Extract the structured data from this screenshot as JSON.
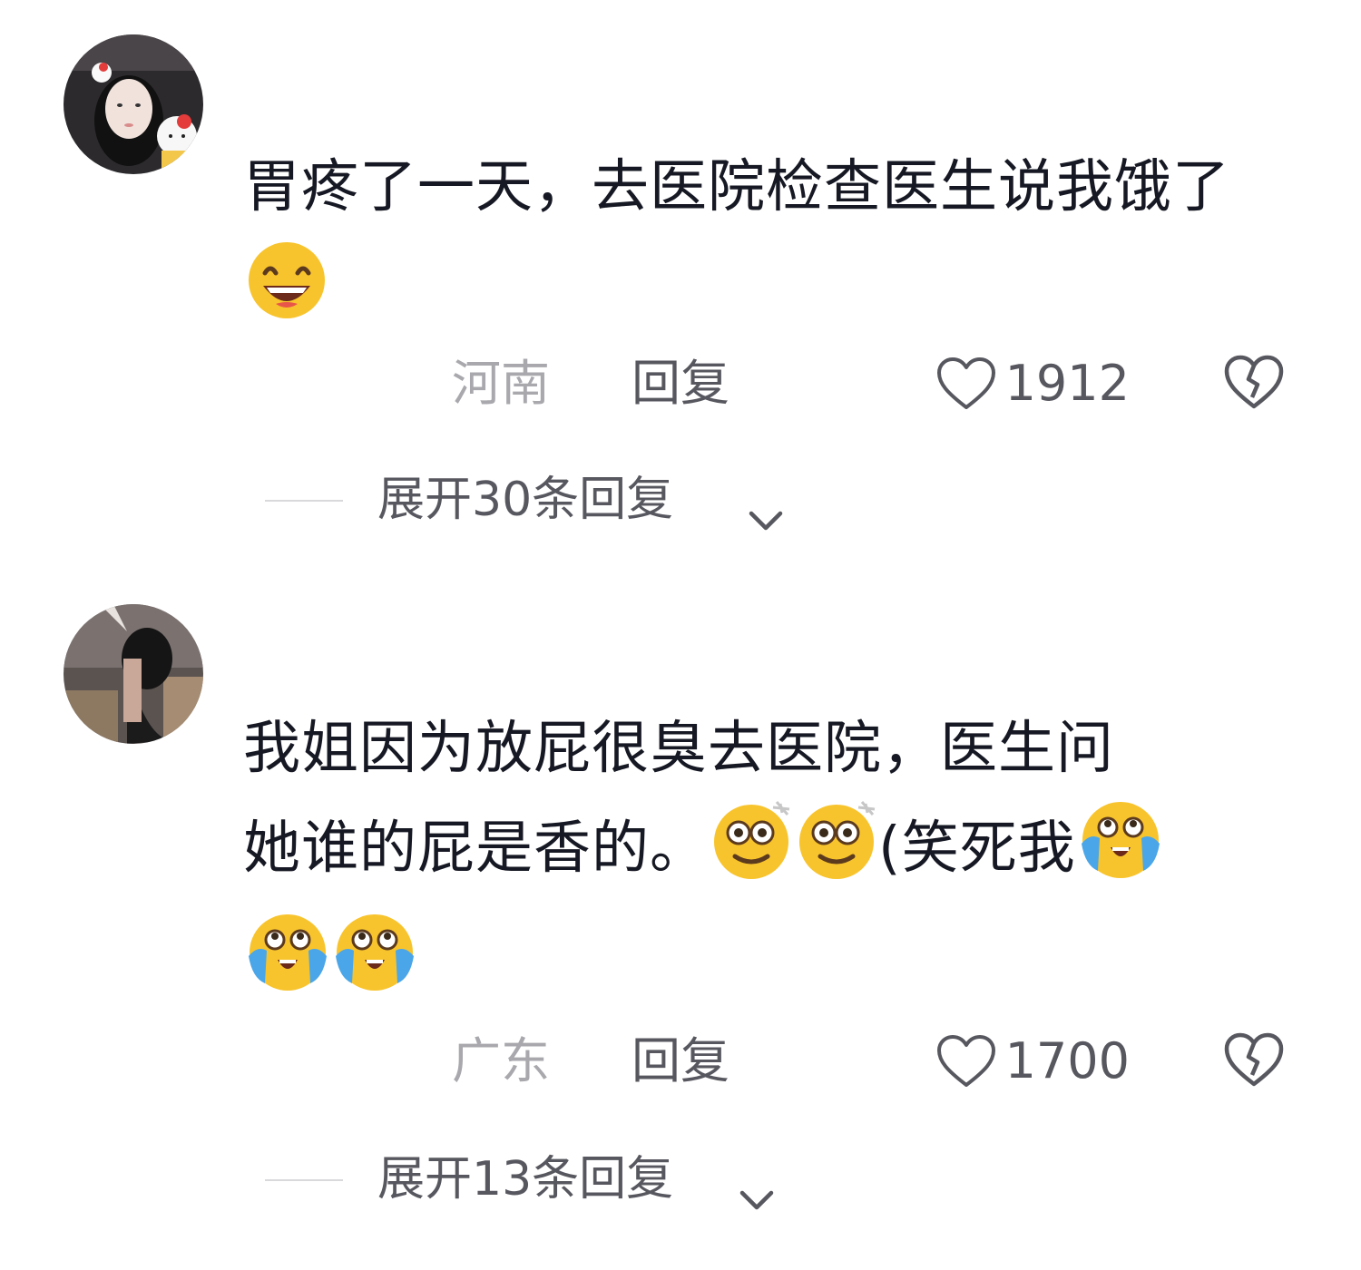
{
  "comments": [
    {
      "text": "胃疼了一天，去医院检查医生说我饿了",
      "emojis": [
        "grinning-face-emoji"
      ],
      "location": "河南",
      "reply_label": "回复",
      "likes": "1912",
      "expand_label": "展开30条回复",
      "icons": {
        "like": "heart-outline-icon",
        "dislike": "broken-heart-icon",
        "expand": "chevron-down-icon"
      }
    },
    {
      "text_line1": "我姐因为放屁很臭去医院，医生问",
      "text_line2": "她谁的屁是香的。",
      "text_line3": "(笑死我",
      "emojis": [
        "dizzy-smile-emoji",
        "dizzy-smile-emoji",
        "loudly-crying-laughing-emoji",
        "loudly-crying-laughing-emoji",
        "loudly-crying-laughing-emoji"
      ],
      "location": "广东",
      "reply_label": "回复",
      "likes": "1700",
      "expand_label": "展开13条回复",
      "icons": {
        "like": "heart-outline-icon",
        "dislike": "broken-heart-icon",
        "expand": "chevron-down-icon"
      }
    }
  ],
  "colors": {
    "text_primary": "#161823",
    "text_secondary": "#57575f",
    "text_location": "#a8a8ad",
    "divider": "#d9d9dc"
  }
}
